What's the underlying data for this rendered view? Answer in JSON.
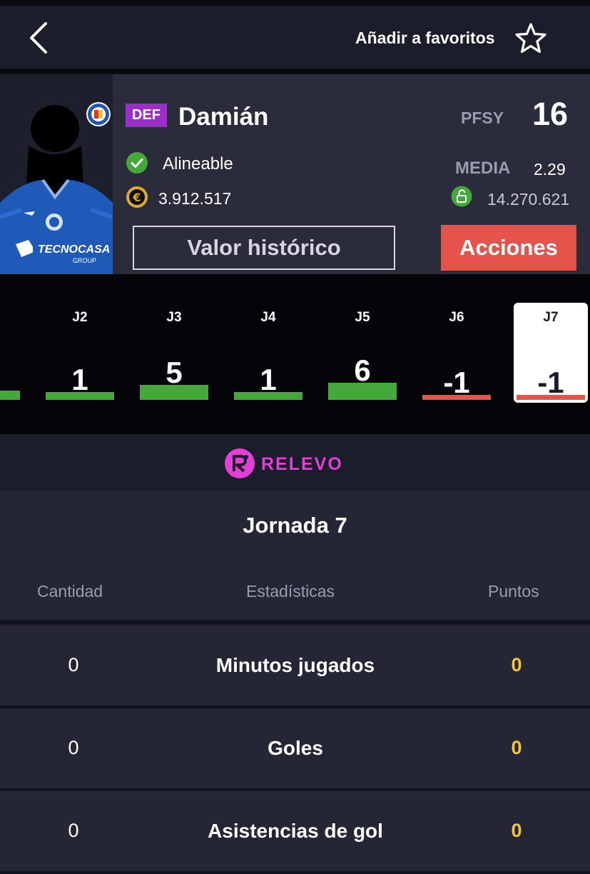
{
  "header": {
    "back_icon": "chevron-left-icon",
    "favorites_label": "Añadir a favoritos",
    "favorites_icon": "star-outline-icon"
  },
  "player": {
    "position": "DEF",
    "name": "Damián",
    "status": "Alineable",
    "market_value": "3.912.517",
    "pfsy_label": "PFSY",
    "pfsy_value": "16",
    "media_label": "MEDIA",
    "media_value": "2.29",
    "clause_value": "14.270.621",
    "history_button": "Valor histórico",
    "actions_button": "Acciones",
    "colors": {
      "position_badge": "#9b2fc7",
      "actions_button": "#e4544b"
    }
  },
  "rounds": [
    {
      "label": "",
      "points": "",
      "value": 2,
      "partial": true
    },
    {
      "label": "J2",
      "points": "1",
      "value": 1
    },
    {
      "label": "J3",
      "points": "5",
      "value": 5
    },
    {
      "label": "J4",
      "points": "1",
      "value": 1
    },
    {
      "label": "J5",
      "points": "6",
      "value": 6
    },
    {
      "label": "J6",
      "points": "-1",
      "value": -1
    },
    {
      "label": "J7",
      "points": "-1",
      "value": -1,
      "selected": true
    }
  ],
  "round_colors": {
    "positive": "#45a83b",
    "negative": "#e4544b"
  },
  "sponsor": {
    "name": "RELEVO",
    "color": "#e33fd7"
  },
  "jornada": {
    "title": "Jornada 7",
    "columns": {
      "quantity": "Cantidad",
      "stat": "Estadísticas",
      "points": "Puntos"
    }
  },
  "stats": [
    {
      "quantity": "0",
      "name": "Minutos jugados",
      "points": "0"
    },
    {
      "quantity": "0",
      "name": "Goles",
      "points": "0"
    },
    {
      "quantity": "0",
      "name": "Asistencias de gol",
      "points": "0"
    }
  ]
}
